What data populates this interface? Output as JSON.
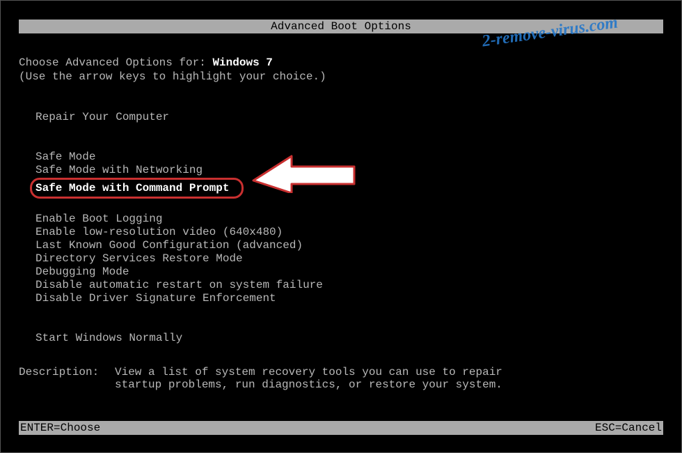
{
  "title": "Advanced Boot Options",
  "prompt": {
    "prefix": "Choose Advanced Options for: ",
    "os": "Windows 7",
    "instruction": "(Use the arrow keys to highlight your choice.)"
  },
  "menu": {
    "group1": [
      "Repair Your Computer"
    ],
    "group2": [
      "Safe Mode",
      "Safe Mode with Networking",
      "Safe Mode with Command Prompt"
    ],
    "group3": [
      "Enable Boot Logging",
      "Enable low-resolution video (640x480)",
      "Last Known Good Configuration (advanced)",
      "Directory Services Restore Mode",
      "Debugging Mode",
      "Disable automatic restart on system failure",
      "Disable Driver Signature Enforcement"
    ],
    "group4": [
      "Start Windows Normally"
    ],
    "highlighted_index": 2
  },
  "description": {
    "label": "Description:",
    "text_line1": "View a list of system recovery tools you can use to repair",
    "text_line2": "startup problems, run diagnostics, or restore your system."
  },
  "footer": {
    "left": "ENTER=Choose",
    "right": "ESC=Cancel"
  },
  "watermark": "2-remove-virus.com",
  "colors": {
    "highlight_border": "#c93030",
    "watermark_color": "#2577c9"
  }
}
